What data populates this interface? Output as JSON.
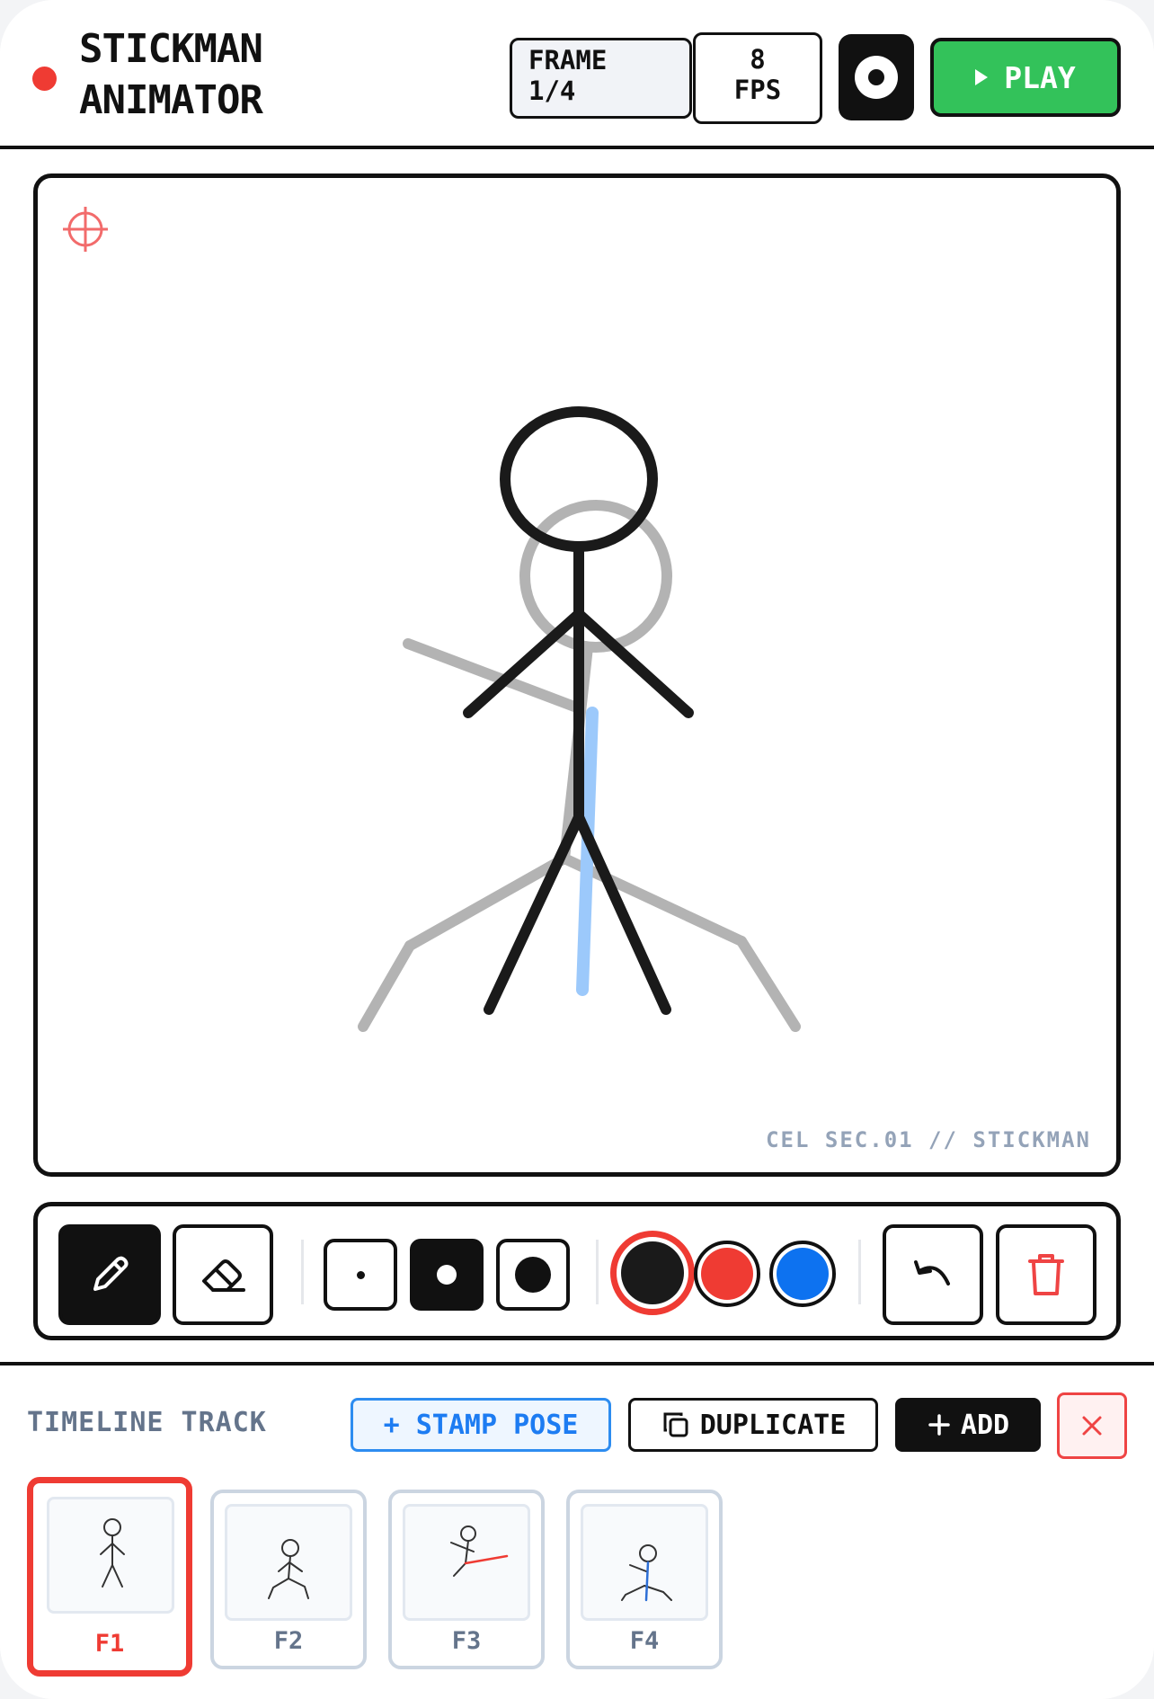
{
  "header": {
    "title": "STICKMAN\nANIMATOR",
    "frame_label": "FRAME\n1/4",
    "fps_label": "8\nFPS",
    "onion_icon": "onion-skin-toggle-icon",
    "play_label": "PLAY",
    "record_dot_color": "#ef3b33"
  },
  "canvas": {
    "corner_label": "CEL SEC.01 // STICKMAN",
    "target_icon": "crosshair-icon"
  },
  "toolbar": {
    "tools": [
      {
        "name": "pencil",
        "icon": "pencil-icon",
        "active": true
      },
      {
        "name": "eraser",
        "icon": "eraser-icon",
        "active": false
      }
    ],
    "brush_sizes": [
      "small",
      "medium",
      "large"
    ],
    "selected_brush_size": "medium",
    "colors": [
      "#1a1a1a",
      "#ef3b33",
      "#0d72f0"
    ],
    "selected_color": "#1a1a1a",
    "undo_icon": "undo-icon",
    "trash_icon": "trash-icon"
  },
  "timeline": {
    "title": "TIMELINE TRACK",
    "stamp_label": "+ STAMP POSE",
    "duplicate_label": "DUPLICATE",
    "add_label": "ADD",
    "delete_icon": "close-icon",
    "frames": [
      {
        "label": "F1",
        "active": true
      },
      {
        "label": "F2",
        "active": false
      },
      {
        "label": "F3",
        "active": false
      },
      {
        "label": "F4",
        "active": false
      }
    ]
  }
}
